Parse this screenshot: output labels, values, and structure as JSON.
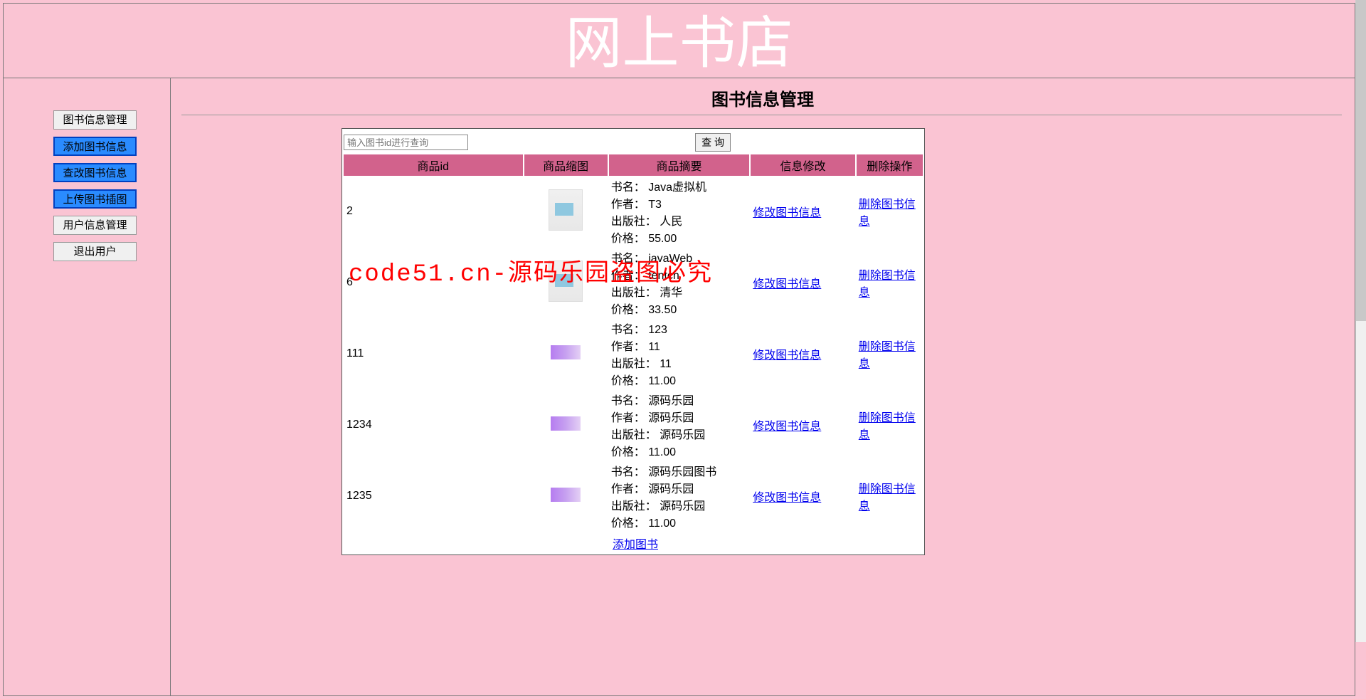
{
  "header": {
    "title": "网上书店"
  },
  "sidebar": {
    "items": [
      {
        "label": "图书信息管理",
        "active": false
      },
      {
        "label": "添加图书信息",
        "active": true
      },
      {
        "label": "查改图书信息",
        "active": true
      },
      {
        "label": "上传图书插图",
        "active": true
      },
      {
        "label": "用户信息管理",
        "active": false
      },
      {
        "label": "退出用户",
        "active": false
      }
    ]
  },
  "main": {
    "page_title": "图书信息管理",
    "search_placeholder": "输入图书id进行查询",
    "search_button": "查  询",
    "table": {
      "headers": [
        "商品id",
        "商品缩图",
        "商品摘要",
        "信息修改",
        "删除操作"
      ],
      "labels": {
        "name": "书名：",
        "author": "作者：",
        "publisher": "出版社：",
        "price": "价格："
      },
      "modify_link": "修改图书信息",
      "delete_link": "删除图书信息",
      "add_link": "添加图书",
      "rows": [
        {
          "id": "2",
          "thumb": "a",
          "name": "Java虚拟机",
          "author": "T3",
          "publisher": "人民",
          "price": "55.00"
        },
        {
          "id": "6",
          "thumb": "a",
          "name": "javaWeb",
          "author": "tentch",
          "publisher": "清华",
          "price": "33.50"
        },
        {
          "id": "111",
          "thumb": "b",
          "name": "123",
          "author": "11",
          "publisher": "11",
          "price": "11.00"
        },
        {
          "id": "1234",
          "thumb": "b",
          "name": "源码乐园",
          "author": "源码乐园",
          "publisher": "源码乐园",
          "price": "11.00"
        },
        {
          "id": "1235",
          "thumb": "b",
          "name": "源码乐园图书",
          "author": "源码乐园",
          "publisher": "源码乐园",
          "price": "11.00"
        }
      ]
    }
  },
  "watermark": "code51.cn-源码乐园盗图必究"
}
